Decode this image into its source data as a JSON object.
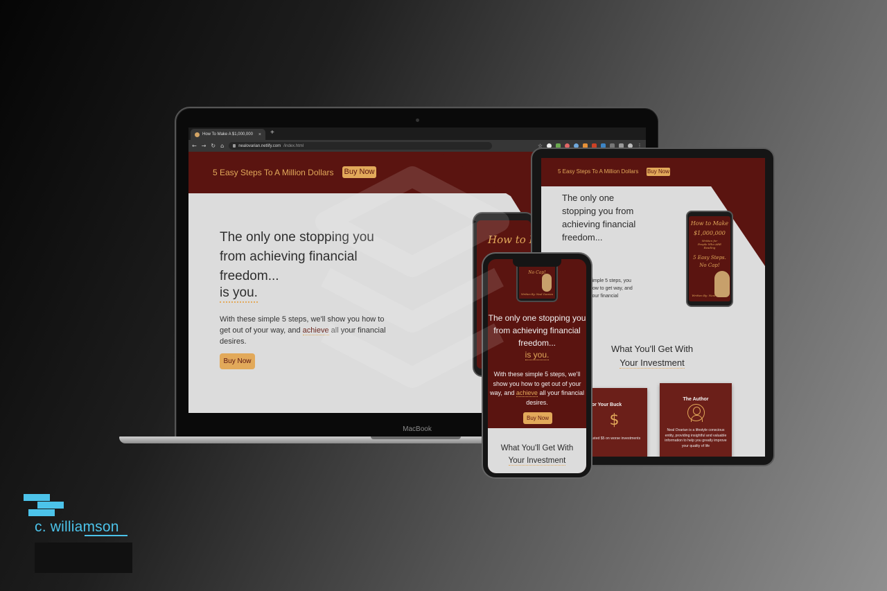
{
  "browser": {
    "tab_title": "How To Make A $1,000,000",
    "tab_close": "×",
    "new_tab": "+",
    "url_host": "nealovarian.netlify.com",
    "url_path": "/index.html"
  },
  "laptop": {
    "label": "MacBook",
    "site": {
      "nav_title": "5 Easy Steps To A Million Dollars",
      "nav_button": "Buy Now",
      "hero_heading": "The only one stopping you from achieving financial freedom...",
      "hero_is_you": "is you.",
      "hero_text_1": "With these simple 5 steps, we'll show you how to get out of your way, and",
      "hero_highlight": "achieve",
      "hero_text_2": "all",
      "hero_text_3": "your financial desires.",
      "hero_button": "Buy Now",
      "phone_cover_text": "How to Ma"
    }
  },
  "tablet": {
    "nav_title": "5 Easy Steps To A Million Dollars",
    "nav_button": "Buy Now",
    "hero_heading": "The only one stopping you from achieving financial freedom...",
    "hero_text": "simple 5 steps, you how to get way, and your financial",
    "cover": {
      "line1": "How to Make",
      "line2": "$1,000,000",
      "line3": "Written for People Who ARE Reading",
      "line4": "5 Easy Steps.",
      "line5": "No Cap!",
      "line6": "Written By: Neal Ovarian"
    },
    "section_line1": "What You'll Get With",
    "section_line2": "Your Investment",
    "card1": {
      "title": "ng for Your Buck",
      "icon": "$",
      "text": "'ve wasted $5 on worse investments"
    },
    "card2": {
      "title": "The Author",
      "text": "Neal Ovarian is a lifestyle conscious entity, providing insightful and valuable information to help you greatly improve your quality of life"
    }
  },
  "phone": {
    "cover_text": "No Cap!",
    "cover_author": "Written By: Neal Ovarian",
    "hero_heading": "The only one stopping you from achieving financial freedom...",
    "hero_is_you": "is you.",
    "hero_text_1": "With these simple 5 steps, we'll show you how to get out of your way, and",
    "hero_highlight": "achieve",
    "hero_text_2": "all your financial desires.",
    "hero_button": "Buy Now",
    "section_line1": "What You'll Get With",
    "section_line2": "Your Investment"
  },
  "logo": {
    "text": "c. williamson",
    "accent_color": "#4cc3ea"
  },
  "colors": {
    "brand_red": "#5a1410",
    "brand_gold": "#e2a95a",
    "page_gray": "#dcdcdc"
  }
}
